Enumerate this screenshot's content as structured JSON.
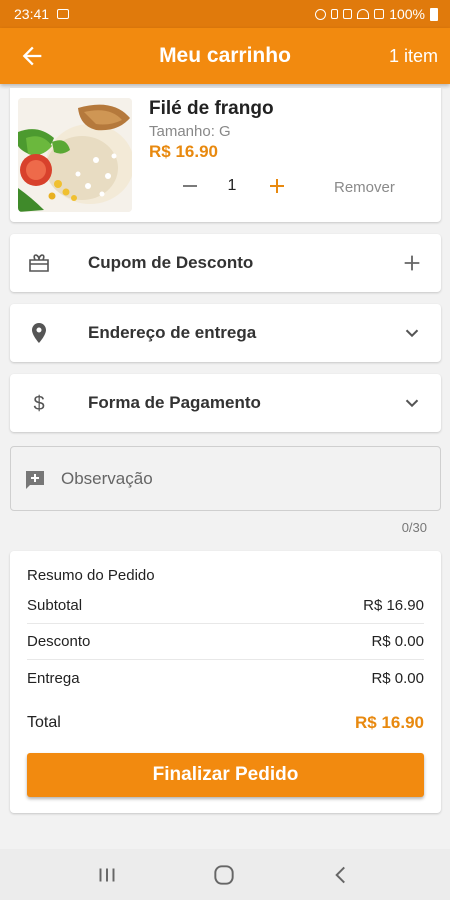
{
  "status_bar": {
    "time": "23:41",
    "battery": "100%"
  },
  "header": {
    "title": "Meu carrinho",
    "item_count": "1 item"
  },
  "cart_item": {
    "name": "Filé de frango",
    "size": "Tamanho: G",
    "price": "R$ 16.90",
    "quantity": "1",
    "remove_label": "Remover"
  },
  "coupon": {
    "label": "Cupom de Desconto"
  },
  "address": {
    "label": "Endereço de entrega"
  },
  "payment": {
    "label": "Forma de Pagamento"
  },
  "observation": {
    "placeholder": "Observação",
    "counter": "0/30"
  },
  "summary": {
    "title": "Resumo do Pedido",
    "rows": [
      {
        "label": "Subtotal",
        "value": "R$ 16.90"
      },
      {
        "label": "Desconto",
        "value": "R$ 0.00"
      },
      {
        "label": "Entrega",
        "value": "R$ 0.00"
      }
    ],
    "total_label": "Total",
    "total_value": "R$ 16.90",
    "finalize_label": "Finalizar Pedido"
  },
  "colors": {
    "accent": "#f28a0f",
    "price": "#e8890f",
    "status_bar": "#e07a0c"
  }
}
